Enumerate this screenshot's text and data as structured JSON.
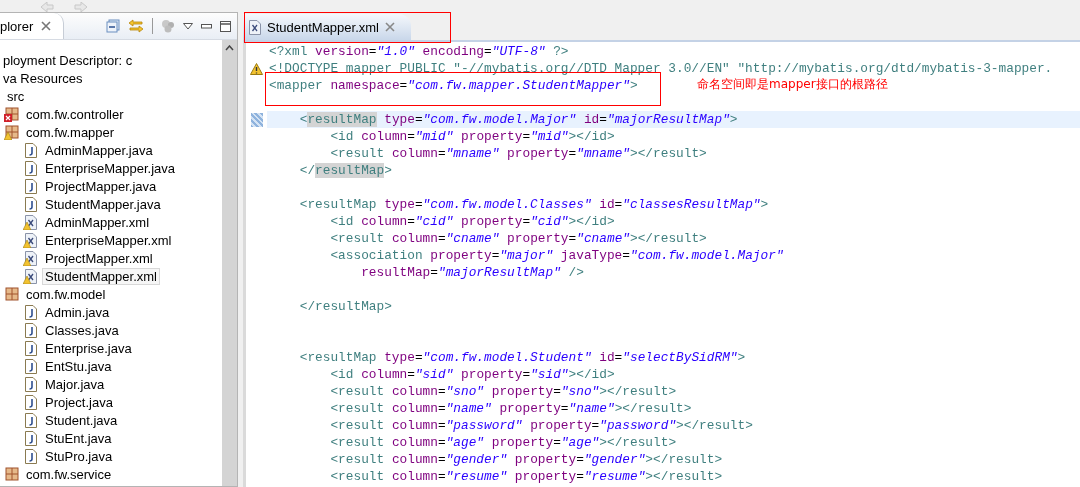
{
  "explorer": {
    "tab": {
      "label": "plorer"
    },
    "tree": [
      {
        "label": "ployment Descriptor: c",
        "selected": false
      },
      {
        "label": "va Resources",
        "selected": false,
        "children": [
          {
            "label": "src",
            "selected": false,
            "children": [
              {
                "label": "com.fw.controller",
                "kind": "package",
                "error": true,
                "warning": false,
                "selected": false
              },
              {
                "label": "com.fw.mapper",
                "kind": "package",
                "error": false,
                "warning": true,
                "selected": false,
                "children": [
                  {
                    "label": "AdminMapper.java",
                    "kind": "java",
                    "error": false,
                    "warning": false,
                    "selected": false
                  },
                  {
                    "label": "EnterpriseMapper.java",
                    "kind": "java",
                    "error": false,
                    "warning": false,
                    "selected": false
                  },
                  {
                    "label": "ProjectMapper.java",
                    "kind": "java",
                    "error": false,
                    "warning": false,
                    "selected": false
                  },
                  {
                    "label": "StudentMapper.java",
                    "kind": "java",
                    "error": false,
                    "warning": false,
                    "selected": false
                  },
                  {
                    "label": "AdminMapper.xml",
                    "kind": "xml",
                    "error": false,
                    "warning": true,
                    "selected": false
                  },
                  {
                    "label": "EnterpriseMapper.xml",
                    "kind": "xml",
                    "error": false,
                    "warning": true,
                    "selected": false
                  },
                  {
                    "label": "ProjectMapper.xml",
                    "kind": "xml",
                    "error": false,
                    "warning": true,
                    "selected": false
                  },
                  {
                    "label": "StudentMapper.xml",
                    "kind": "xml",
                    "error": false,
                    "warning": true,
                    "selected": true
                  }
                ]
              },
              {
                "label": "com.fw.model",
                "kind": "package",
                "error": false,
                "warning": false,
                "selected": false,
                "children": [
                  {
                    "label": "Admin.java",
                    "kind": "java",
                    "error": false,
                    "warning": false,
                    "selected": false
                  },
                  {
                    "label": "Classes.java",
                    "kind": "java",
                    "error": false,
                    "warning": false,
                    "selected": false
                  },
                  {
                    "label": "Enterprise.java",
                    "kind": "java",
                    "error": false,
                    "warning": false,
                    "selected": false
                  },
                  {
                    "label": "EntStu.java",
                    "kind": "java",
                    "error": false,
                    "warning": false,
                    "selected": false
                  },
                  {
                    "label": "Major.java",
                    "kind": "java",
                    "error": false,
                    "warning": false,
                    "selected": false
                  },
                  {
                    "label": "Project.java",
                    "kind": "java",
                    "error": false,
                    "warning": false,
                    "selected": false
                  },
                  {
                    "label": "Student.java",
                    "kind": "java",
                    "error": false,
                    "warning": false,
                    "selected": false
                  },
                  {
                    "label": "StuEnt.java",
                    "kind": "java",
                    "error": false,
                    "warning": false,
                    "selected": false
                  },
                  {
                    "label": "StuPro.java",
                    "kind": "java",
                    "error": false,
                    "warning": false,
                    "selected": false
                  }
                ]
              },
              {
                "label": "com.fw.service",
                "kind": "package",
                "error": false,
                "warning": false,
                "selected": false
              }
            ]
          }
        ]
      }
    ]
  },
  "editor": {
    "tabs": [
      {
        "label": "StudentMapper.xml",
        "selected": true
      }
    ],
    "lines": [
      {
        "kind": "code",
        "tokens": [
          {
            "kind": "tag",
            "text": "<?xml"
          },
          {
            "kind": "attr",
            "text": " version"
          },
          {
            "kind": "punct",
            "text": "="
          },
          {
            "kind": "value",
            "text": "\"1.0\""
          },
          {
            "kind": "attr",
            "text": " encoding"
          },
          {
            "kind": "punct",
            "text": "="
          },
          {
            "kind": "value",
            "text": "\"UTF-8\""
          },
          {
            "kind": "tag",
            "text": " ?>"
          }
        ]
      },
      {
        "kind": "warning",
        "tokens": [
          {
            "kind": "doctype",
            "text": "<!DOCTYPE mapper PUBLIC \"-//mybatis.org//DTD Mapper 3.0//EN\" \"http://mybatis.org/dtd/mybatis-3-mapper."
          }
        ]
      },
      {
        "kind": "code",
        "tokens": [
          {
            "kind": "tag",
            "text": "<mapper"
          },
          {
            "kind": "attr",
            "text": " namespace"
          },
          {
            "kind": "punct",
            "text": "="
          },
          {
            "kind": "value",
            "text": "\"com.fw.mapper.StudentMapper\""
          },
          {
            "kind": "tag",
            "text": ">"
          }
        ]
      },
      {
        "kind": "blank"
      },
      {
        "kind": "current",
        "tokens": [
          {
            "kind": "tag",
            "text": "    <"
          },
          {
            "kind": "tag",
            "text": "resultMap",
            "occurrence": true
          },
          {
            "kind": "attr",
            "text": " type"
          },
          {
            "kind": "punct",
            "text": "="
          },
          {
            "kind": "value",
            "text": "\"com.fw.model.Major\""
          },
          {
            "kind": "attr",
            "text": " id"
          },
          {
            "kind": "punct",
            "text": "="
          },
          {
            "kind": "value",
            "text": "\"majorResultMap\""
          },
          {
            "kind": "tag",
            "text": ">"
          }
        ]
      },
      {
        "kind": "code",
        "tokens": [
          {
            "kind": "tag",
            "text": "        <id"
          },
          {
            "kind": "attr",
            "text": " column"
          },
          {
            "kind": "punct",
            "text": "="
          },
          {
            "kind": "value",
            "text": "\"mid\""
          },
          {
            "kind": "attr",
            "text": " property"
          },
          {
            "kind": "punct",
            "text": "="
          },
          {
            "kind": "value",
            "text": "\"mid\""
          },
          {
            "kind": "tag",
            "text": "></id>"
          }
        ]
      },
      {
        "kind": "code",
        "tokens": [
          {
            "kind": "tag",
            "text": "        <result"
          },
          {
            "kind": "attr",
            "text": " column"
          },
          {
            "kind": "punct",
            "text": "="
          },
          {
            "kind": "value",
            "text": "\"mname\""
          },
          {
            "kind": "attr",
            "text": " property"
          },
          {
            "kind": "punct",
            "text": "="
          },
          {
            "kind": "value",
            "text": "\"mname\""
          },
          {
            "kind": "tag",
            "text": "></result>"
          }
        ]
      },
      {
        "kind": "code",
        "tokens": [
          {
            "kind": "tag",
            "text": "    </"
          },
          {
            "kind": "tag",
            "text": "resultMap",
            "occurrence": true
          },
          {
            "kind": "tag",
            "text": ">"
          }
        ]
      },
      {
        "kind": "blank"
      },
      {
        "kind": "code",
        "tokens": [
          {
            "kind": "tag",
            "text": "    <resultMap"
          },
          {
            "kind": "attr",
            "text": " type"
          },
          {
            "kind": "punct",
            "text": "="
          },
          {
            "kind": "value",
            "text": "\"com.fw.model.Classes\""
          },
          {
            "kind": "attr",
            "text": " id"
          },
          {
            "kind": "punct",
            "text": "="
          },
          {
            "kind": "value",
            "text": "\"classesResultMap\""
          },
          {
            "kind": "tag",
            "text": ">"
          }
        ]
      },
      {
        "kind": "code",
        "tokens": [
          {
            "kind": "tag",
            "text": "        <id"
          },
          {
            "kind": "attr",
            "text": " column"
          },
          {
            "kind": "punct",
            "text": "="
          },
          {
            "kind": "value",
            "text": "\"cid\""
          },
          {
            "kind": "attr",
            "text": " property"
          },
          {
            "kind": "punct",
            "text": "="
          },
          {
            "kind": "value",
            "text": "\"cid\""
          },
          {
            "kind": "tag",
            "text": "></id>"
          }
        ]
      },
      {
        "kind": "code",
        "tokens": [
          {
            "kind": "tag",
            "text": "        <result"
          },
          {
            "kind": "attr",
            "text": " column"
          },
          {
            "kind": "punct",
            "text": "="
          },
          {
            "kind": "value",
            "text": "\"cname\""
          },
          {
            "kind": "attr",
            "text": " property"
          },
          {
            "kind": "punct",
            "text": "="
          },
          {
            "kind": "value",
            "text": "\"cname\""
          },
          {
            "kind": "tag",
            "text": "></result>"
          }
        ]
      },
      {
        "kind": "code",
        "tokens": [
          {
            "kind": "tag",
            "text": "        <association"
          },
          {
            "kind": "attr",
            "text": " property"
          },
          {
            "kind": "punct",
            "text": "="
          },
          {
            "kind": "value",
            "text": "\"major\""
          },
          {
            "kind": "attr",
            "text": " javaType"
          },
          {
            "kind": "punct",
            "text": "="
          },
          {
            "kind": "value",
            "text": "\"com.fw.model.Major\""
          }
        ]
      },
      {
        "kind": "code",
        "tokens": [
          {
            "kind": "attr",
            "text": "            resultMap"
          },
          {
            "kind": "punct",
            "text": "="
          },
          {
            "kind": "value",
            "text": "\"majorResultMap\""
          },
          {
            "kind": "tag",
            "text": " />"
          }
        ]
      },
      {
        "kind": "blank"
      },
      {
        "kind": "code",
        "tokens": [
          {
            "kind": "tag",
            "text": "    </resultMap>"
          }
        ]
      },
      {
        "kind": "blank"
      },
      {
        "kind": "blank"
      },
      {
        "kind": "code",
        "tokens": [
          {
            "kind": "tag",
            "text": "    <resultMap"
          },
          {
            "kind": "attr",
            "text": " type"
          },
          {
            "kind": "punct",
            "text": "="
          },
          {
            "kind": "value",
            "text": "\"com.fw.model.Student\""
          },
          {
            "kind": "attr",
            "text": " id"
          },
          {
            "kind": "punct",
            "text": "="
          },
          {
            "kind": "value",
            "text": "\"selectBySidRM\""
          },
          {
            "kind": "tag",
            "text": ">"
          }
        ]
      },
      {
        "kind": "code",
        "tokens": [
          {
            "kind": "tag",
            "text": "        <id"
          },
          {
            "kind": "attr",
            "text": " column"
          },
          {
            "kind": "punct",
            "text": "="
          },
          {
            "kind": "value",
            "text": "\"sid\""
          },
          {
            "kind": "attr",
            "text": " property"
          },
          {
            "kind": "punct",
            "text": "="
          },
          {
            "kind": "value",
            "text": "\"sid\""
          },
          {
            "kind": "tag",
            "text": "></id>"
          }
        ]
      },
      {
        "kind": "code",
        "tokens": [
          {
            "kind": "tag",
            "text": "        <result"
          },
          {
            "kind": "attr",
            "text": " column"
          },
          {
            "kind": "punct",
            "text": "="
          },
          {
            "kind": "value",
            "text": "\"sno\""
          },
          {
            "kind": "attr",
            "text": " property"
          },
          {
            "kind": "punct",
            "text": "="
          },
          {
            "kind": "value",
            "text": "\"sno\""
          },
          {
            "kind": "tag",
            "text": "></result>"
          }
        ]
      },
      {
        "kind": "code",
        "tokens": [
          {
            "kind": "tag",
            "text": "        <result"
          },
          {
            "kind": "attr",
            "text": " column"
          },
          {
            "kind": "punct",
            "text": "="
          },
          {
            "kind": "value",
            "text": "\"name\""
          },
          {
            "kind": "attr",
            "text": " property"
          },
          {
            "kind": "punct",
            "text": "="
          },
          {
            "kind": "value",
            "text": "\"name\""
          },
          {
            "kind": "tag",
            "text": "></result>"
          }
        ]
      },
      {
        "kind": "code",
        "tokens": [
          {
            "kind": "tag",
            "text": "        <result"
          },
          {
            "kind": "attr",
            "text": " column"
          },
          {
            "kind": "punct",
            "text": "="
          },
          {
            "kind": "value",
            "text": "\"password\""
          },
          {
            "kind": "attr",
            "text": " property"
          },
          {
            "kind": "punct",
            "text": "="
          },
          {
            "kind": "value",
            "text": "\"password\""
          },
          {
            "kind": "tag",
            "text": "></result>"
          }
        ]
      },
      {
        "kind": "code",
        "tokens": [
          {
            "kind": "tag",
            "text": "        <result"
          },
          {
            "kind": "attr",
            "text": " column"
          },
          {
            "kind": "punct",
            "text": "="
          },
          {
            "kind": "value",
            "text": "\"age\""
          },
          {
            "kind": "attr",
            "text": " property"
          },
          {
            "kind": "punct",
            "text": "="
          },
          {
            "kind": "value",
            "text": "\"age\""
          },
          {
            "kind": "tag",
            "text": "></result>"
          }
        ]
      },
      {
        "kind": "code",
        "tokens": [
          {
            "kind": "tag",
            "text": "        <result"
          },
          {
            "kind": "attr",
            "text": " column"
          },
          {
            "kind": "punct",
            "text": "="
          },
          {
            "kind": "value",
            "text": "\"gender\""
          },
          {
            "kind": "attr",
            "text": " property"
          },
          {
            "kind": "punct",
            "text": "="
          },
          {
            "kind": "value",
            "text": "\"gender\""
          },
          {
            "kind": "tag",
            "text": "></result>"
          }
        ]
      },
      {
        "kind": "code",
        "tokens": [
          {
            "kind": "tag",
            "text": "        <result"
          },
          {
            "kind": "attr",
            "text": " column"
          },
          {
            "kind": "punct",
            "text": "="
          },
          {
            "kind": "value",
            "text": "\"resume\""
          },
          {
            "kind": "attr",
            "text": " property"
          },
          {
            "kind": "punct",
            "text": "="
          },
          {
            "kind": "value",
            "text": "\"resume\""
          },
          {
            "kind": "tag",
            "text": "></result>"
          }
        ]
      }
    ]
  },
  "annotation": {
    "note": "命名空间即是mapper接口的根路径"
  }
}
